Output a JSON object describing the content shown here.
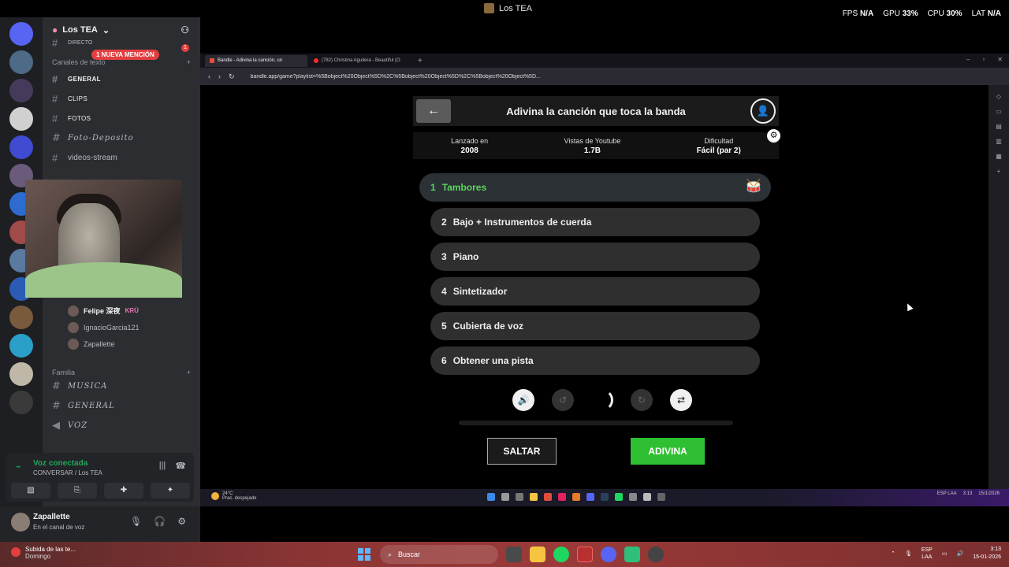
{
  "overlay": {
    "window_title": "Los TEA",
    "fps_label": "FPS",
    "fps_value": "N/A",
    "gpu_label": "GPU",
    "gpu_value": "33%",
    "cpu_label": "CPU",
    "cpu_value": "30%",
    "lat_label": "LAT",
    "lat_value": "N/A"
  },
  "discord": {
    "server_name": "Los TEA",
    "direct_label": "DIRECTO",
    "mention_badge": "1 NUEVA MENCIÓN",
    "unread_count": "1",
    "text_category": "Canales de texto",
    "channels": [
      {
        "name": "GENERAL"
      },
      {
        "name": "CLIPS"
      },
      {
        "name": "FOTOS"
      },
      {
        "name": "Foto-Deposito"
      },
      {
        "name": "videos-stream"
      }
    ],
    "voice_users": [
      {
        "name": "Felipe 深夜",
        "tag": "KRÜ"
      },
      {
        "name": "IgnacioGarcia121",
        "tag": ""
      },
      {
        "name": "Zapallette",
        "tag": ""
      }
    ],
    "family_category": "Familia",
    "family_channels": [
      {
        "name": "MUSICA"
      },
      {
        "name": "GENERAL"
      },
      {
        "name": "VOZ"
      }
    ],
    "voice_status": "Voz conectada",
    "voice_channel": "CONVERSAR / Los TEA",
    "user_name": "Zapallette",
    "user_status": "En el canal de voz"
  },
  "browser": {
    "tabs": [
      {
        "label": "Bandle - Adivina la canción, un"
      },
      {
        "label": "(782) Christina Aguilera - Beautiful (O"
      }
    ],
    "url": "bandle.app/game?playlist=%5Bobject%20Object%5D%2C%5Bobject%20Object%5D%2C%5Bobject%20Object%5D..."
  },
  "game": {
    "title": "Adivina la canción que toca la banda",
    "info": [
      {
        "label": "Lanzado en",
        "value": "2008"
      },
      {
        "label": "Vistas de Youtube",
        "value": "1.7B"
      },
      {
        "label": "Dificultad",
        "value": "Fácil (par 2)"
      }
    ],
    "steps": [
      {
        "num": "1",
        "label": "Tambores"
      },
      {
        "num": "2",
        "label": "Bajo + Instrumentos de cuerda"
      },
      {
        "num": "3",
        "label": "Piano"
      },
      {
        "num": "4",
        "label": "Sintetizador"
      },
      {
        "num": "5",
        "label": "Cubierta de voz"
      },
      {
        "num": "6",
        "label": "Obtener una pista"
      }
    ],
    "progress_fraction": 0,
    "skip_label": "SALTAR",
    "guess_label": "ADIVINA"
  },
  "inner_taskbar": {
    "weather_temp": "24°C",
    "weather_text": "Prac. despejado",
    "lang": "ESP LAA",
    "time": "3:13",
    "date": "15/1/2026"
  },
  "taskbar": {
    "news_title": "Subida de las te...",
    "news_sub": "Domingo",
    "search_placeholder": "Buscar",
    "lang": "ESP",
    "lang2": "LAA",
    "time": "3:13",
    "date": "15-01-2026"
  }
}
